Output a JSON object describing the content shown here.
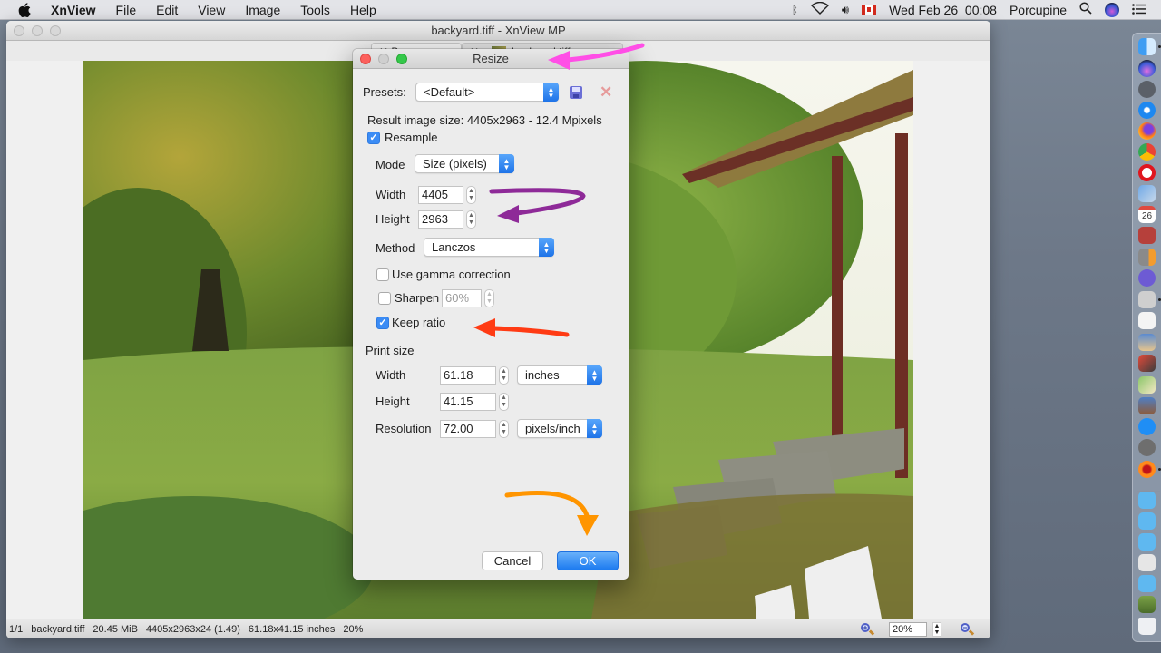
{
  "menubar": {
    "app_name": "XnView",
    "items": [
      "File",
      "Edit",
      "View",
      "Image",
      "Tools",
      "Help"
    ],
    "status": {
      "datetime": "Wed Feb 26  00:08",
      "user": "Porcupine",
      "icons": [
        "bluetooth-icon",
        "wifi-icon",
        "volume-icon",
        "canada-flag-icon",
        "spotlight-search-icon",
        "siri-icon",
        "notification-center-icon"
      ]
    }
  },
  "window": {
    "title": "backyard.tiff - XnView MP",
    "tabs": [
      {
        "label": "Browser",
        "closable": true
      },
      {
        "label": "backyard.tiff",
        "closable": true
      }
    ]
  },
  "statusbar": {
    "index": "1/1",
    "filename": "backyard.tiff",
    "filesize": "20.45 MiB",
    "dimensions": "4405x2963x24 (1.49)",
    "print_size": "61.18x41.15 inches",
    "zoom_percent": "20%",
    "zoom_input": "20%"
  },
  "dialog": {
    "title": "Resize",
    "presets": {
      "label": "Presets:",
      "value": "<Default>"
    },
    "result_text": "Result image size: 4405x2963 - 12.4 Mpixels",
    "resample": {
      "label": "Resample",
      "checked": true
    },
    "mode": {
      "label": "Mode",
      "value": "Size (pixels)"
    },
    "width": {
      "label": "Width",
      "value": "4405"
    },
    "height": {
      "label": "Height",
      "value": "2963"
    },
    "method": {
      "label": "Method",
      "value": "Lanczos"
    },
    "gamma": {
      "label": "Use gamma correction",
      "checked": false
    },
    "sharpen": {
      "label": "Sharpen",
      "checked": false,
      "value": "60%"
    },
    "keep_ratio": {
      "label": "Keep ratio",
      "checked": true
    },
    "print_size": {
      "section_label": "Print size",
      "width_label": "Width",
      "width_value": "61.18",
      "width_unit": "inches",
      "height_label": "Height",
      "height_value": "41.15",
      "resolution_label": "Resolution",
      "resolution_value": "72.00",
      "resolution_unit": "pixels/inch"
    },
    "buttons": {
      "cancel": "Cancel",
      "ok": "OK"
    }
  },
  "annotations": {
    "colors": {
      "magenta": "#ff4ee6",
      "purple": "#8e2a98",
      "red": "#ff3b14",
      "orange": "#ff9500"
    }
  },
  "dock": {
    "items": [
      "Finder",
      "Siri",
      "Launchpad",
      "Safari",
      "Firefox",
      "Chrome",
      "Opera",
      "Mail",
      "Calendar",
      "Dictionary",
      "Calculator",
      "BBEdit",
      "Preview-like Utility",
      "TextEdit",
      "Photo Viewer",
      "Image Capture",
      "Maps",
      "Photos",
      "App Store",
      "System Preferences",
      "XnView MP",
      "Folder",
      "Folder",
      "Folder",
      "Document",
      "Folder",
      "Image",
      "Trash"
    ],
    "calendar_day": "26"
  }
}
